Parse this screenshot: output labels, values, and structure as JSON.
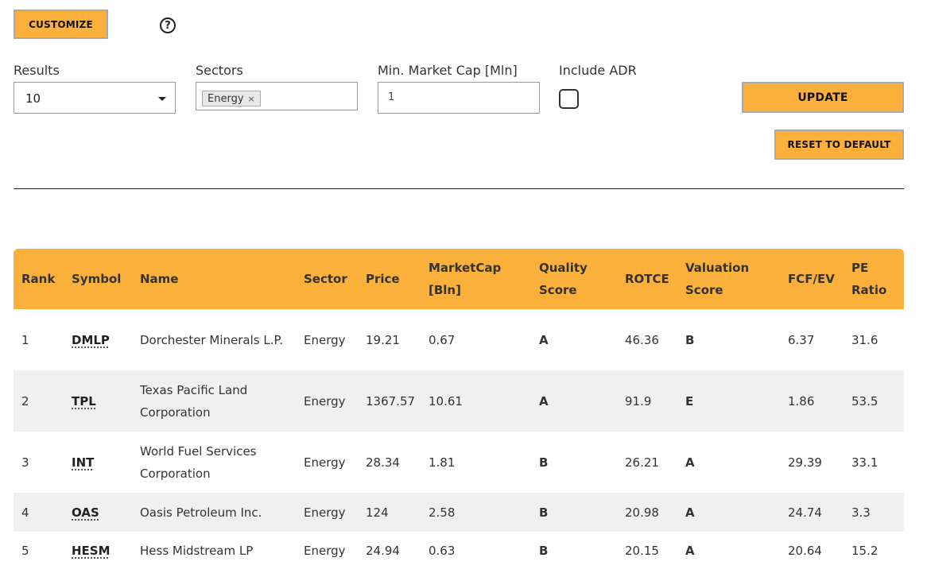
{
  "toolbar": {
    "customize_label": "CUSTOMIZE",
    "help_icon": "?"
  },
  "filters": {
    "results_label": "Results",
    "results_value": "10",
    "sectors_label": "Sectors",
    "sector_chip": "Energy",
    "chip_remove": "×",
    "mincap_label": "Min. Market Cap [Mln]",
    "mincap_value": "1",
    "adr_label": "Include ADR"
  },
  "actions": {
    "update_label": "UPDATE",
    "reset_label": "RESET TO DEFAULT"
  },
  "table": {
    "headers": [
      "Rank",
      "Symbol",
      "Name",
      "Sector",
      "Price",
      "MarketCap [Bln]",
      "Quality Score",
      "ROTCE",
      "Valuation Score",
      "FCF/EV",
      "PE Ratio"
    ],
    "rows": [
      {
        "rank": "1",
        "symbol": "DMLP",
        "name": "Dorchester Minerals L.P.",
        "sector": "Energy",
        "price": "19.21",
        "marketcap": "0.67",
        "quality": "A",
        "rotce": "46.36",
        "valuation": "B",
        "fcf_ev": "6.37",
        "pe": "31.6"
      },
      {
        "rank": "2",
        "symbol": "TPL",
        "name": "Texas Pacific Land Corporation",
        "sector": "Energy",
        "price": "1367.57",
        "marketcap": "10.61",
        "quality": "A",
        "rotce": "91.9",
        "valuation": "E",
        "fcf_ev": "1.86",
        "pe": "53.5"
      },
      {
        "rank": "3",
        "symbol": "INT",
        "name": "World Fuel Services Corporation",
        "sector": "Energy",
        "price": "28.34",
        "marketcap": "1.81",
        "quality": "B",
        "rotce": "26.21",
        "valuation": "A",
        "fcf_ev": "29.39",
        "pe": "33.1"
      },
      {
        "rank": "4",
        "symbol": "OAS",
        "name": "Oasis Petroleum Inc.",
        "sector": "Energy",
        "price": "124",
        "marketcap": "2.58",
        "quality": "B",
        "rotce": "20.98",
        "valuation": "A",
        "fcf_ev": "24.74",
        "pe": "3.3"
      },
      {
        "rank": "5",
        "symbol": "HESM",
        "name": "Hess Midstream LP",
        "sector": "Energy",
        "price": "24.94",
        "marketcap": "0.63",
        "quality": "B",
        "rotce": "20.15",
        "valuation": "A",
        "fcf_ev": "20.64",
        "pe": "15.2"
      }
    ]
  },
  "colors": {
    "accent": "#fbb03b",
    "row_alt": "#f0f0f0"
  }
}
